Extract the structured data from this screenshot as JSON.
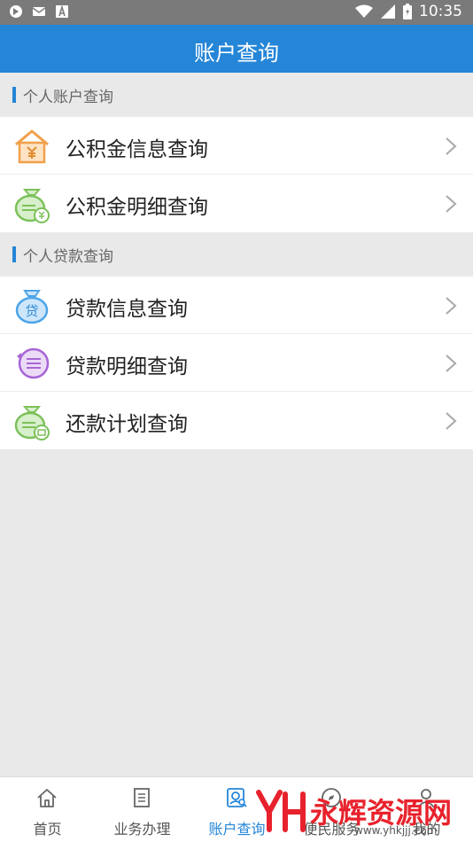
{
  "status_bar": {
    "time": "10:35",
    "icons": [
      "browser-icon",
      "mail-icon",
      "text-a-icon",
      "wifi-icon",
      "signal-icon",
      "battery-icon"
    ]
  },
  "header": {
    "title": "账户查询"
  },
  "sections": [
    {
      "title": "个人账户查询",
      "items": [
        {
          "label": "公积金信息查询",
          "icon": "house-yuan-icon"
        },
        {
          "label": "公积金明细查询",
          "icon": "money-bag-yuan-icon"
        }
      ]
    },
    {
      "title": "个人贷款查询",
      "items": [
        {
          "label": "贷款信息查询",
          "icon": "loan-bag-icon"
        },
        {
          "label": "贷款明细查询",
          "icon": "list-circle-icon"
        },
        {
          "label": "还款计划查询",
          "icon": "repayment-bag-icon"
        }
      ]
    }
  ],
  "tab_bar": {
    "tabs": [
      {
        "label": "首页",
        "icon": "home-icon",
        "active": false
      },
      {
        "label": "业务办理",
        "icon": "document-icon",
        "active": false
      },
      {
        "label": "账户查询",
        "icon": "account-search-icon",
        "active": true
      },
      {
        "label": "便民服务",
        "icon": "compass-icon",
        "active": false
      },
      {
        "label": "我的",
        "icon": "user-icon",
        "active": false
      }
    ]
  },
  "watermark": {
    "text": "永辉资源网",
    "url": "www.yhkjjj.com"
  },
  "colors": {
    "primary": "#2586d8",
    "status_bar": "#7a7a7a",
    "background": "#e9e9e9",
    "watermark": "#e8222c"
  }
}
